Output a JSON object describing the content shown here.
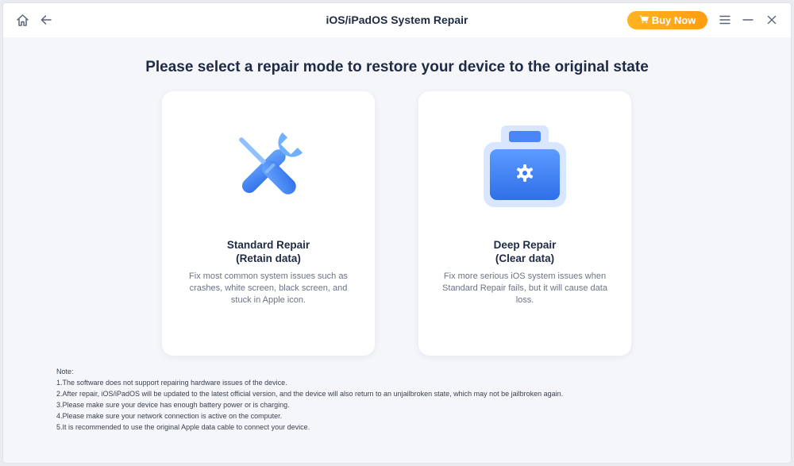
{
  "app": {
    "title": "iOS/iPadOS System Repair",
    "buy_label": "Buy Now"
  },
  "icons": {
    "home": "home-icon",
    "back": "arrow-left-icon",
    "cart": "cart-icon",
    "menu": "menu-icon",
    "minimize": "minimize-icon",
    "close": "close-icon"
  },
  "main": {
    "heading": "Please select a repair mode to restore your device to the original state"
  },
  "cards": [
    {
      "title_line1": "Standard Repair",
      "title_line2": "(Retain data)",
      "description": "Fix most common system  issues such as crashes, white screen, black screen, and stuck in Apple icon.",
      "icon": "wrench-screwdriver-icon"
    },
    {
      "title_line1": "Deep Repair",
      "title_line2": "(Clear data)",
      "description": "Fix more serious iOS system  issues when Standard Repair fails, but it will cause data loss.",
      "icon": "toolbox-icon"
    }
  ],
  "notes": {
    "label": "Note:",
    "items": [
      "1.The software does not support repairing hardware issues of the device.",
      "2.After repair, iOS/iPadOS will be updated to the latest official version, and the device will also return to an unjailbroken state, which may not be jailbroken again.",
      "3.Please make sure your device has enough battery power or is charging.",
      "4.Please make sure your network connection is active on the computer.",
      "5.It is recommended to use the original Apple data cable to connect your device."
    ]
  },
  "colors": {
    "accent_blue": "#4a86f7",
    "buy_orange": "#ffa519",
    "text_dark": "#1f2a44"
  }
}
